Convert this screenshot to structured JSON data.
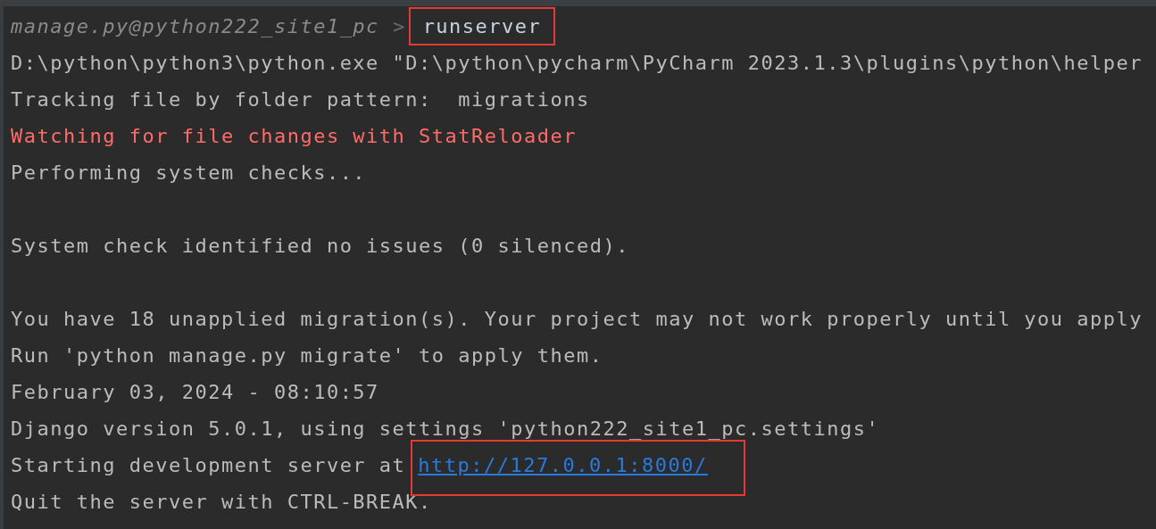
{
  "console": {
    "lines": [
      {
        "kind": "prompt",
        "prompt": "manage.py@python222_site1_pc",
        "marker": ">",
        "command": "runserver",
        "highlighted": true
      },
      {
        "kind": "output",
        "text": "D:\\python\\python3\\python.exe \"D:\\python\\pycharm\\PyCharm 2023.1.3\\plugins\\python\\helper"
      },
      {
        "kind": "output",
        "text": "Tracking file by folder pattern:  migrations"
      },
      {
        "kind": "error",
        "text": "Watching for file changes with StatReloader"
      },
      {
        "kind": "output",
        "text": "Performing system checks..."
      },
      {
        "kind": "blank"
      },
      {
        "kind": "output",
        "text": "System check identified no issues (0 silenced)."
      },
      {
        "kind": "blank"
      },
      {
        "kind": "output",
        "text": "You have 18 unapplied migration(s). Your project may not work properly until you apply"
      },
      {
        "kind": "output",
        "text": "Run 'python manage.py migrate' to apply them."
      },
      {
        "kind": "output",
        "text": "February 03, 2024 - 08:10:57"
      },
      {
        "kind": "output",
        "text": "Django version 5.0.1, using settings 'python222_site1_pc.settings'"
      },
      {
        "kind": "link",
        "text": "Starting development server at",
        "url": "http://127.0.0.1:8000/",
        "highlighted": true
      },
      {
        "kind": "output",
        "text": "Quit the server with CTRL-BREAK."
      }
    ]
  }
}
